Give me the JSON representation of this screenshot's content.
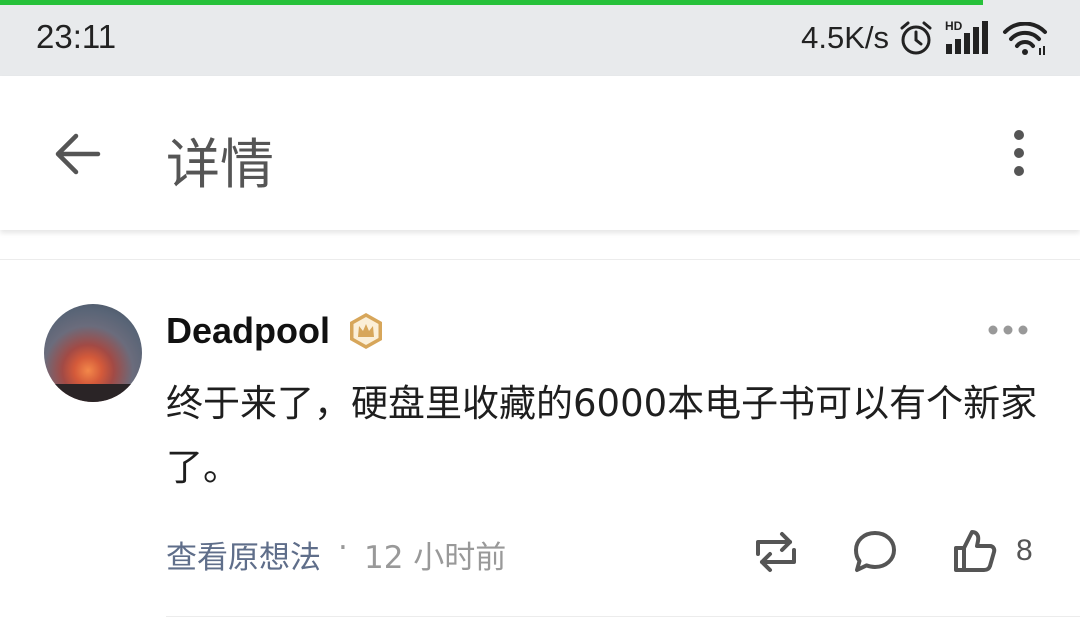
{
  "status_bar": {
    "time": "23:11",
    "net_speed": "4.5K/s",
    "icons": [
      "alarm-icon",
      "hd-signal-icon",
      "wifi-icon"
    ],
    "load_progress_percent": 91
  },
  "app_bar": {
    "title": "详情",
    "back_icon": "arrow-left-icon",
    "more_icon": "vertical-dots-icon"
  },
  "comment": {
    "username": "Deadpool",
    "badge_icon": "crown-badge-icon",
    "text": "终于来了，硬盘里收藏的6000本电子书可以有个新家了。",
    "view_thoughts_label": "查看原想法",
    "separator": "·",
    "timestamp": "12 小时前",
    "like_count": "8"
  },
  "colors": {
    "progress": "#27c13a",
    "status_bar_bg": "#e8eaec",
    "link": "#5f6e8a",
    "badge_gold": "#d7a65a",
    "meta_gray": "#999999"
  }
}
